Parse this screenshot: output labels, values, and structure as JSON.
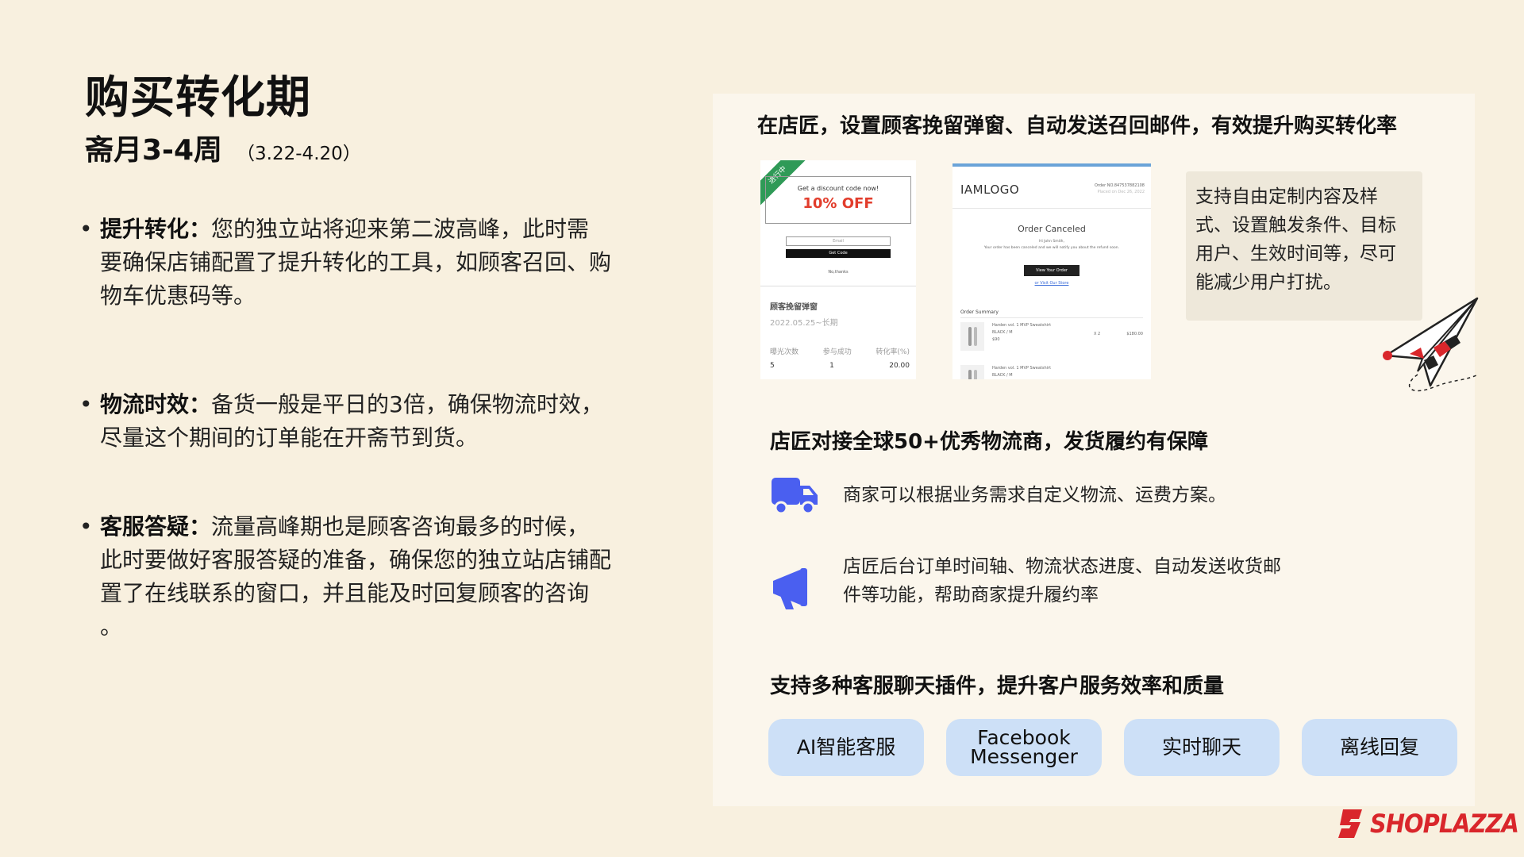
{
  "page": {
    "title": "购买转化期",
    "subtitle": "斋月3-4周",
    "date_range": "（3.22-4.20）"
  },
  "bullets": [
    {
      "label": "提升转化",
      "sep": "：",
      "text": "您的独立站将迎来第二波高峰，此时需要确保店铺配置了提升转化的工具，如顾客召回、购物车优惠码等。"
    },
    {
      "label": "物流时效",
      "sep": "：",
      "text": "备货一般是平日的3倍，确保物流时效，尽量这个期间的订单能在开斋节到货。"
    },
    {
      "label": "客服答疑",
      "sep": "：",
      "text": "流量高峰期也是顾客咨询最多的时候，此时要做好客服答疑的准备，确保您的独立站店铺配置了在线联系的窗口，并且能及时回复顾客的咨询 。"
    }
  ],
  "panel": {
    "heading": "在店匠，设置顾客挽留弹窗、自动发送召回邮件，有效提升购买转化率",
    "popup_mock": {
      "ribbon": "进行中",
      "small": "Get a discount code now!",
      "offer": "10% OFF",
      "input": "Email",
      "button": "Get Code",
      "link": "No,thanks",
      "stat_title": "顾客挽留弹窗",
      "stat_date": "2022.05.25~长期",
      "stat_headers": [
        "曝光次数",
        "参与成功",
        "转化率(%)"
      ],
      "stat_values": [
        "5",
        "1",
        "20.00"
      ]
    },
    "email_mock": {
      "logo": "IAMLOGO",
      "order_no": "Order NO.847537882108",
      "placed_on": "Placed on Dec 26, 2022",
      "status": "Order Canceled",
      "line1": "Hi John Smith,",
      "line2": "Your order has been canceled and we will notify you about the refund soon.",
      "button": "View Your Order",
      "visit": "or Visit Our Store",
      "summary": "Order Summary",
      "items": [
        {
          "name": "Harden vol. 1 MVP Sweatshirt",
          "variant": "BLACK / M",
          "price_small": "$90",
          "qty": "X 2",
          "total": "$180.00"
        },
        {
          "name": "Harden vol. 1 MVP Sweatshirt",
          "variant": "BLACK / M",
          "price_small": "",
          "qty": "",
          "total": ""
        }
      ]
    },
    "tip_text": "支持自由定制内容及样式、设置触发条件、目标用户、生效时间等，尽可能减少用户打扰。",
    "logistics_heading": "店匠对接全球50+优秀物流商，发货履约有保障",
    "features": [
      {
        "icon": "truck-icon",
        "text": "商家可以根据业务需求自定义物流、运费方案。"
      },
      {
        "icon": "megaphone-icon",
        "text": "店匠后台订单时间轴、物流状态进度、自动发送收货邮件等功能，帮助商家提升履约率"
      }
    ],
    "service_heading": "支持多种客服聊天插件，提升客户服务效率和质量",
    "pills": [
      "AI智能客服",
      "Facebook Messenger",
      "实时聊天",
      "离线回复"
    ]
  },
  "brand": {
    "name": "SHOPLAZZA",
    "color": "#d9262b"
  },
  "colors": {
    "background": "#f8f0df",
    "panel": "#fbf6ec",
    "accent_blue": "#4a5ff0",
    "pill": "#cde0f7"
  }
}
